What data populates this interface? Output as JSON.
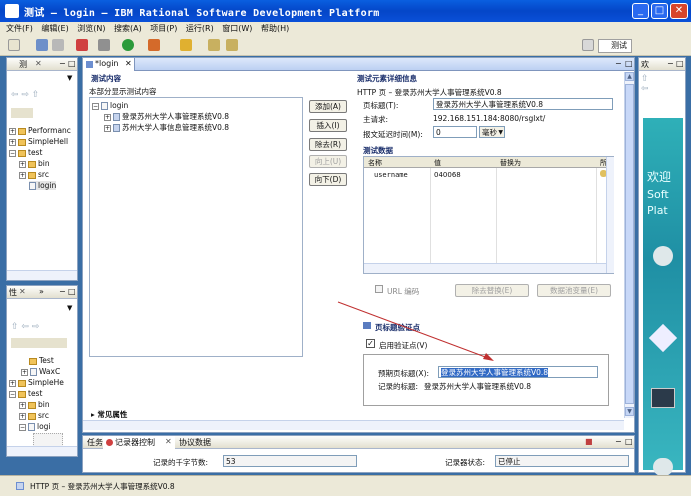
{
  "window": {
    "title": "测试 – login – IBM Rational Software Development Platform"
  },
  "menu": [
    "文件(F)",
    "编辑(E)",
    "浏览(N)",
    "搜索(A)",
    "项目(P)",
    "运行(R)",
    "窗口(W)",
    "帮助(H)"
  ],
  "perspective": {
    "label": "测试"
  },
  "left_top": {
    "tab": "测",
    "tree": [
      "Performanc",
      "SimpleHell",
      "test",
      "bin",
      "src",
      "login"
    ]
  },
  "left_bottom": {
    "tab": "性",
    "tree": [
      "Test",
      "WaxC",
      "SimpleHe",
      "test",
      "bin",
      "src",
      "logi"
    ]
  },
  "editor": {
    "tab": "*login",
    "content_header": "测试内容",
    "content_sub": "本部分显示测试内容",
    "tree": [
      "login",
      "登录苏州大学人事管理系统V0.8",
      "苏州大学人事信息管理系统V0.8"
    ],
    "buttons": [
      "添加(A)",
      "插入(I)",
      "除去(R)",
      "向上(U)",
      "向下(D)"
    ],
    "common_props": "常见属性",
    "details": {
      "header": "测试元素详细信息",
      "http_page": "HTTP 页 – 登录苏州大学人事管理系统V0.8",
      "page_title_label": "页标题(T):",
      "page_title_value": "登录苏州大学人事管理系统V0.8",
      "host_label": "主请求:",
      "host_value": "192.168.151.184:8080/rsglxt/",
      "delay_label": "报文延迟时间(M):",
      "delay_value": "0",
      "delay_unit": "毫秒",
      "test_data_header": "测试数据",
      "columns": [
        "名称",
        "值",
        "替换为",
        "所"
      ],
      "row": {
        "name": "username",
        "value": "040068"
      },
      "url_encode": "URL 编码",
      "btn_remove_sub": "除去替换(E)",
      "btn_data_sub": "数据池变量(E)",
      "verify_header": "页标题验证点",
      "enable_verify": "启用验证点(V)",
      "expected_label": "预期页标题(X):",
      "expected_value": "登录苏州大学人事管理系统V0.8",
      "recorded_label": "记录的标题:",
      "recorded_value": "登录苏州大学人事管理系统V0.8"
    }
  },
  "bottom": {
    "tabs": [
      "任务",
      "记录器控制",
      "协议数据"
    ],
    "kb_label": "记录的千字节数:",
    "kb_value": "53",
    "status_label": "记录器状态:",
    "status_value": "已停止"
  },
  "right": {
    "tab": "欢",
    "welcome": [
      "欢迎",
      "Soft",
      "Plat"
    ]
  },
  "statusbar": {
    "text": "HTTP 页 – 登录苏州大学人事管理系统V0.8"
  }
}
